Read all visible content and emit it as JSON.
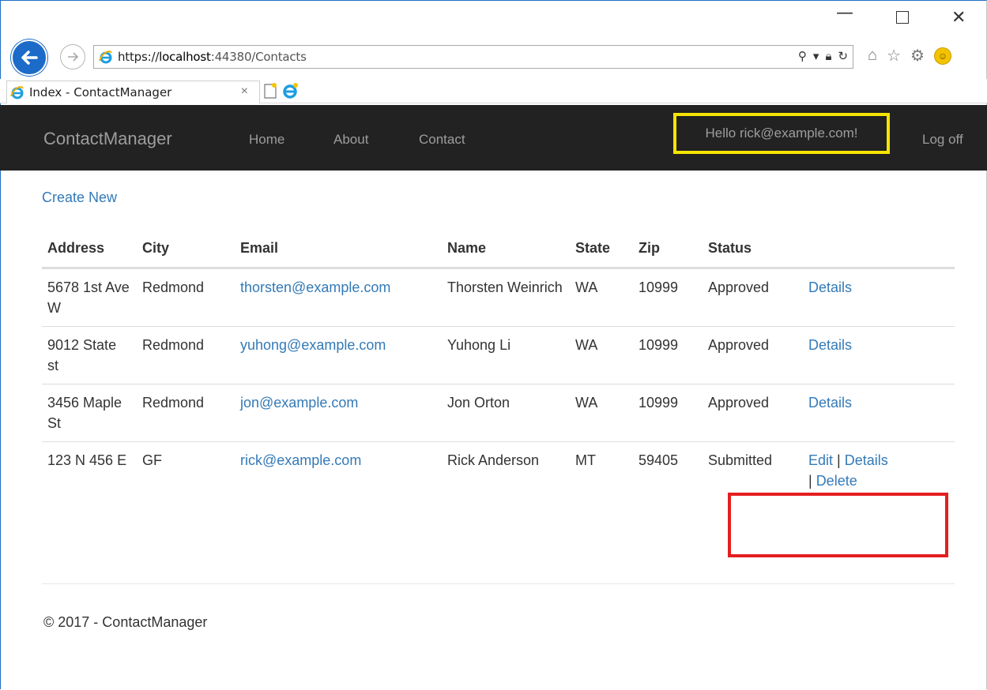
{
  "browser": {
    "url_host_prefix": "https://",
    "url_host": "localhost",
    "url_rest": ":44380/Contacts",
    "tab_title": "Index - ContactManager"
  },
  "navbar": {
    "brand": "ContactManager",
    "links": [
      "Home",
      "About",
      "Contact"
    ],
    "hello": "Hello rick@example.com!",
    "logoff": "Log off"
  },
  "page": {
    "create_new": "Create New",
    "footer": "© 2017 - ContactManager"
  },
  "table": {
    "headers": [
      "Address",
      "City",
      "Email",
      "Name",
      "State",
      "Zip",
      "Status"
    ],
    "rows": [
      {
        "address": "5678 1st Ave W",
        "city": "Redmond",
        "email": "thorsten@example.com",
        "name": "Thorsten Weinrich",
        "state": "WA",
        "zip": "10999",
        "status": "Approved",
        "actions": [
          "Details"
        ]
      },
      {
        "address": "9012 State st",
        "city": "Redmond",
        "email": "yuhong@example.com",
        "name": "Yuhong Li",
        "state": "WA",
        "zip": "10999",
        "status": "Approved",
        "actions": [
          "Details"
        ]
      },
      {
        "address": "3456 Maple St",
        "city": "Redmond",
        "email": "jon@example.com",
        "name": "Jon Orton",
        "state": "WA",
        "zip": "10999",
        "status": "Approved",
        "actions": [
          "Details"
        ]
      },
      {
        "address": "123 N 456 E",
        "city": "GF",
        "email": "rick@example.com",
        "name": "Rick Anderson",
        "state": "MT",
        "zip": "59405",
        "status": "Submitted",
        "actions": [
          "Edit",
          "Details",
          "Delete"
        ]
      }
    ]
  },
  "colors": {
    "navbar_bg": "#222222",
    "link": "#337ab7",
    "highlight_hello": "#f5e400",
    "highlight_actions": "#e41e1e"
  }
}
